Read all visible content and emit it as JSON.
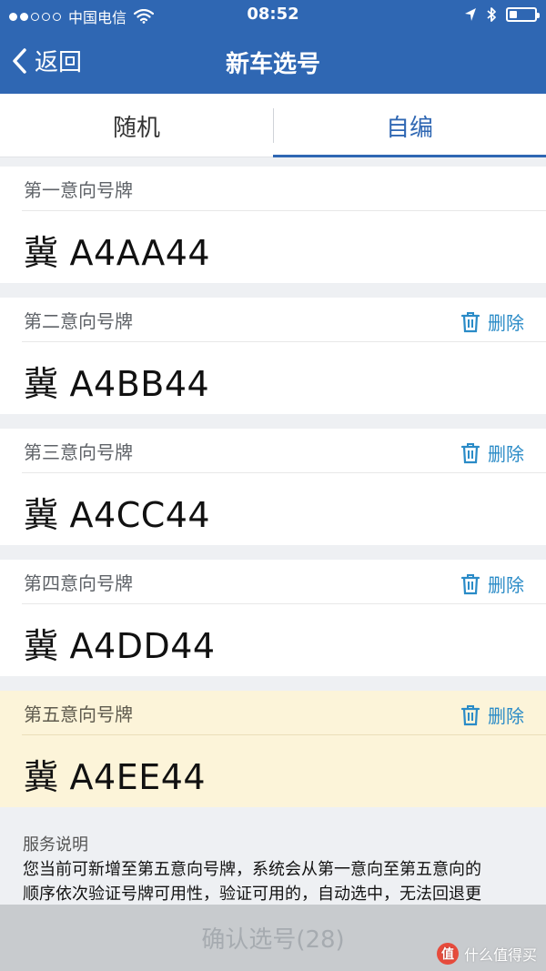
{
  "status_bar": {
    "carrier": "中国电信",
    "time": "08:52"
  },
  "nav": {
    "back_label": "返回",
    "title": "新车选号"
  },
  "tabs": [
    {
      "label": "随机"
    },
    {
      "label": "自编"
    }
  ],
  "plates": [
    {
      "title": "第一意向号牌",
      "prefix": "冀",
      "number": "A4AA44",
      "delete_label": ""
    },
    {
      "title": "第二意向号牌",
      "prefix": "冀",
      "number": "A4BB44",
      "delete_label": "删除"
    },
    {
      "title": "第三意向号牌",
      "prefix": "冀",
      "number": "A4CC44",
      "delete_label": "删除"
    },
    {
      "title": "第四意向号牌",
      "prefix": "冀",
      "number": "A4DD44",
      "delete_label": "删除"
    },
    {
      "title": "第五意向号牌",
      "prefix": "冀",
      "number": "A4EE44",
      "delete_label": "删除"
    }
  ],
  "service": {
    "title": "服务说明",
    "text": "您当前可新增至第五意向号牌，系统会从第一意向至第五意向的\n顺序依次验证号牌可用性，验证可用的，自动选中，无法回退更"
  },
  "confirm": {
    "label": "确认选号(28)"
  },
  "watermark": {
    "badge": "值",
    "text": "什么值得买"
  },
  "colors": {
    "nav_blue": "#2f67b3",
    "link_blue": "#2a8bc7",
    "highlight": "#fcf4d9"
  }
}
